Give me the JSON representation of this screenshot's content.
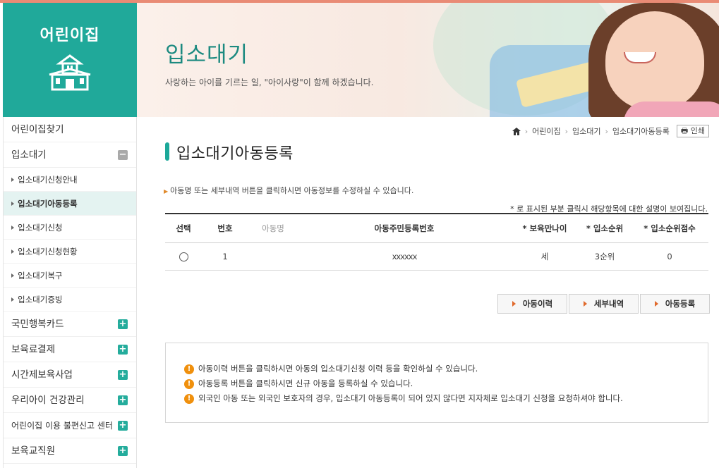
{
  "brand": {
    "title": "어린이집",
    "icon": "nursery-building-icon"
  },
  "banner": {
    "title": "입소대기",
    "subtitle": "사랑하는 아이를 기르는 일, \"아이사랑\"이 함께 하겠습니다."
  },
  "sidebar": {
    "items": [
      {
        "label": "어린이집찾기",
        "type": "main"
      },
      {
        "label": "입소대기",
        "type": "main",
        "toggle": "minus"
      },
      {
        "label": "입소대기신청안내",
        "type": "sub"
      },
      {
        "label": "입소대기아동등록",
        "type": "sub",
        "active": true
      },
      {
        "label": "입소대기신청",
        "type": "sub"
      },
      {
        "label": "입소대기신청현황",
        "type": "sub"
      },
      {
        "label": "입소대기복구",
        "type": "sub"
      },
      {
        "label": "입소대기증빙",
        "type": "sub"
      },
      {
        "label": "국민행복카드",
        "type": "main",
        "toggle": "plus"
      },
      {
        "label": "보육료결제",
        "type": "main",
        "toggle": "plus"
      },
      {
        "label": "시간제보육사업",
        "type": "main",
        "toggle": "plus"
      },
      {
        "label": "우리아이 건강관리",
        "type": "main",
        "toggle": "plus"
      },
      {
        "label": "어린이집 이용 불편신고 센터",
        "type": "main",
        "toggle": "plus"
      },
      {
        "label": "보육교직원",
        "type": "main",
        "toggle": "plus"
      }
    ]
  },
  "breadcrumb": {
    "items": [
      "어린이집",
      "입소대기",
      "입소대기아동등록"
    ],
    "print_label": "인쇄"
  },
  "page": {
    "title": "입소대기아동등록",
    "notice": "아동명 또는 세부내역 버튼을 클릭하시면 아동정보를 수정하실 수 있습니다.",
    "note_right": "* 로 표시된 부분 클릭시 해당항목에 대한 설명이 보여집니다."
  },
  "table": {
    "headers": [
      "선택",
      "번호",
      "아동명",
      "아동주민등록번호",
      "* 보육만나이",
      "* 입소순위",
      "* 입소순위점수"
    ],
    "rows": [
      {
        "no": "1",
        "name": "",
        "rrn": "xxxxxx",
        "age": "세",
        "rank": "3순위",
        "score": "0"
      }
    ]
  },
  "buttons": {
    "history": "아동이력",
    "detail": "세부내역",
    "register": "아동등록"
  },
  "info": [
    "아동이력 버튼을 클릭하시면 아동의 입소대기신청 이력 등을 확인하실 수 있습니다.",
    "아동등록 버튼을 클릭하시면 신규 아동을 등록하실 수 있습니다.",
    "외국인 아동 또는 외국인 보호자의 경우, 입소대기 아동등록이 되어 있지 않다면 지자체로 입소대기 신청을 요청하셔야 합니다."
  ],
  "colors": {
    "accent": "#20a99a",
    "title_green": "#1c8a80",
    "warning": "#f0900d"
  }
}
